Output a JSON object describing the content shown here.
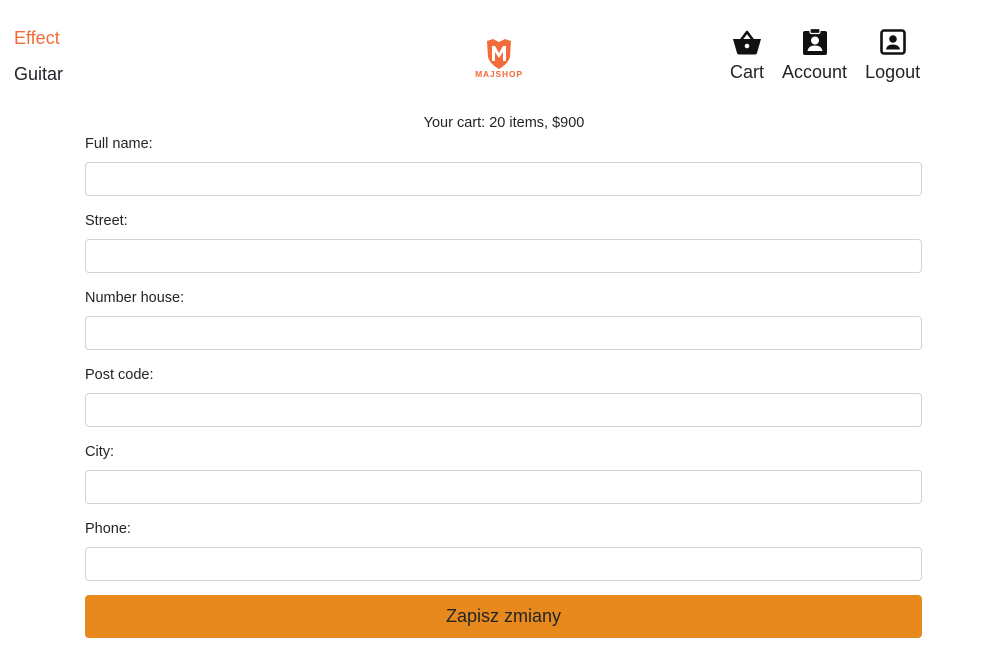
{
  "left_nav": {
    "items": [
      {
        "label": "Effect",
        "active": true
      },
      {
        "label": "Guitar",
        "active": false
      }
    ]
  },
  "logo": {
    "text": "MAJSHOP",
    "letter": "M"
  },
  "right_nav": {
    "items": [
      {
        "label": "Cart",
        "icon": "basket-icon"
      },
      {
        "label": "Account",
        "icon": "account-badge-icon"
      },
      {
        "label": "Logout",
        "icon": "user-box-icon"
      }
    ]
  },
  "cart_summary": {
    "prefix": "Your cart:",
    "detail": "20 items, $900"
  },
  "form": {
    "fields": [
      {
        "label": "Full name:",
        "value": ""
      },
      {
        "label": "Street:",
        "value": ""
      },
      {
        "label": "Number house:",
        "value": ""
      },
      {
        "label": "Post code:",
        "value": ""
      },
      {
        "label": "City:",
        "value": ""
      },
      {
        "label": "Phone:",
        "value": ""
      }
    ],
    "submit_label": "Zapisz zmiany"
  },
  "colors": {
    "accent": "#f26b3a",
    "button": "#e8891e",
    "text": "#212529",
    "input_border": "#ced4da"
  }
}
